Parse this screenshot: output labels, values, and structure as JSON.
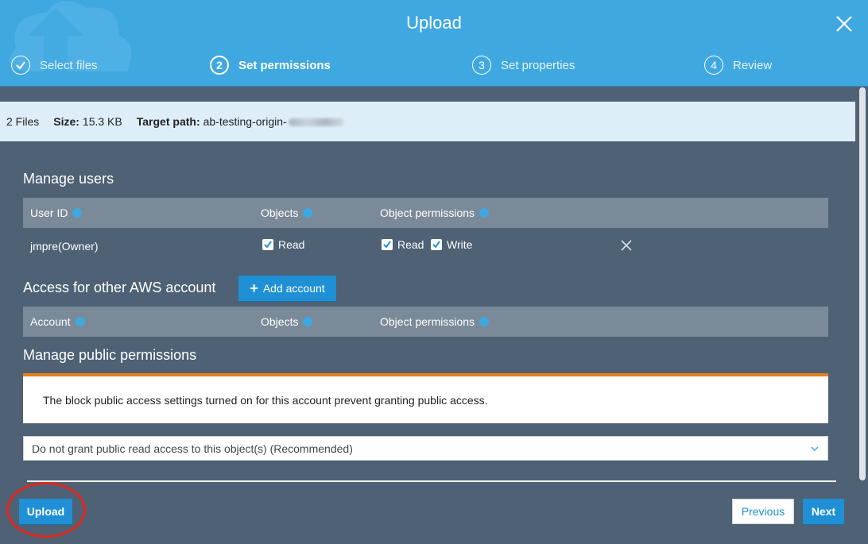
{
  "header": {
    "title": "Upload",
    "steps": [
      {
        "number": "1",
        "label": "Select files",
        "state": "done"
      },
      {
        "number": "2",
        "label": "Set permissions",
        "state": "active"
      },
      {
        "number": "3",
        "label": "Set properties",
        "state": "pending"
      },
      {
        "number": "4",
        "label": "Review",
        "state": "pending"
      }
    ]
  },
  "info": {
    "files": "2 Files",
    "size_label": "Size:",
    "size_value": "15.3 KB",
    "path_label": "Target path:",
    "path_value": "ab-testing-origin-"
  },
  "manage_users": {
    "title": "Manage users",
    "columns": [
      "User ID",
      "Objects",
      "Object permissions"
    ],
    "row": {
      "user": "jmpre(Owner)",
      "objects_read": "Read",
      "perm_read": "Read",
      "perm_write": "Write"
    }
  },
  "other_accounts": {
    "title": "Access for other AWS account",
    "add_label": "Add account",
    "columns": [
      "Account",
      "Objects",
      "Object permissions"
    ]
  },
  "public": {
    "title": "Manage public permissions",
    "alert": "The block public access settings turned on for this account prevent granting public access.",
    "select_value": "Do not grant public read access to this object(s) (Recommended)"
  },
  "footer": {
    "upload": "Upload",
    "previous": "Previous",
    "next": "Next"
  },
  "colors": {
    "header": "#3fa8e1",
    "body": "#4e6175",
    "primary_button": "#1f8fd6",
    "alert_border": "#e8801a",
    "highlight": "#e2261c"
  }
}
